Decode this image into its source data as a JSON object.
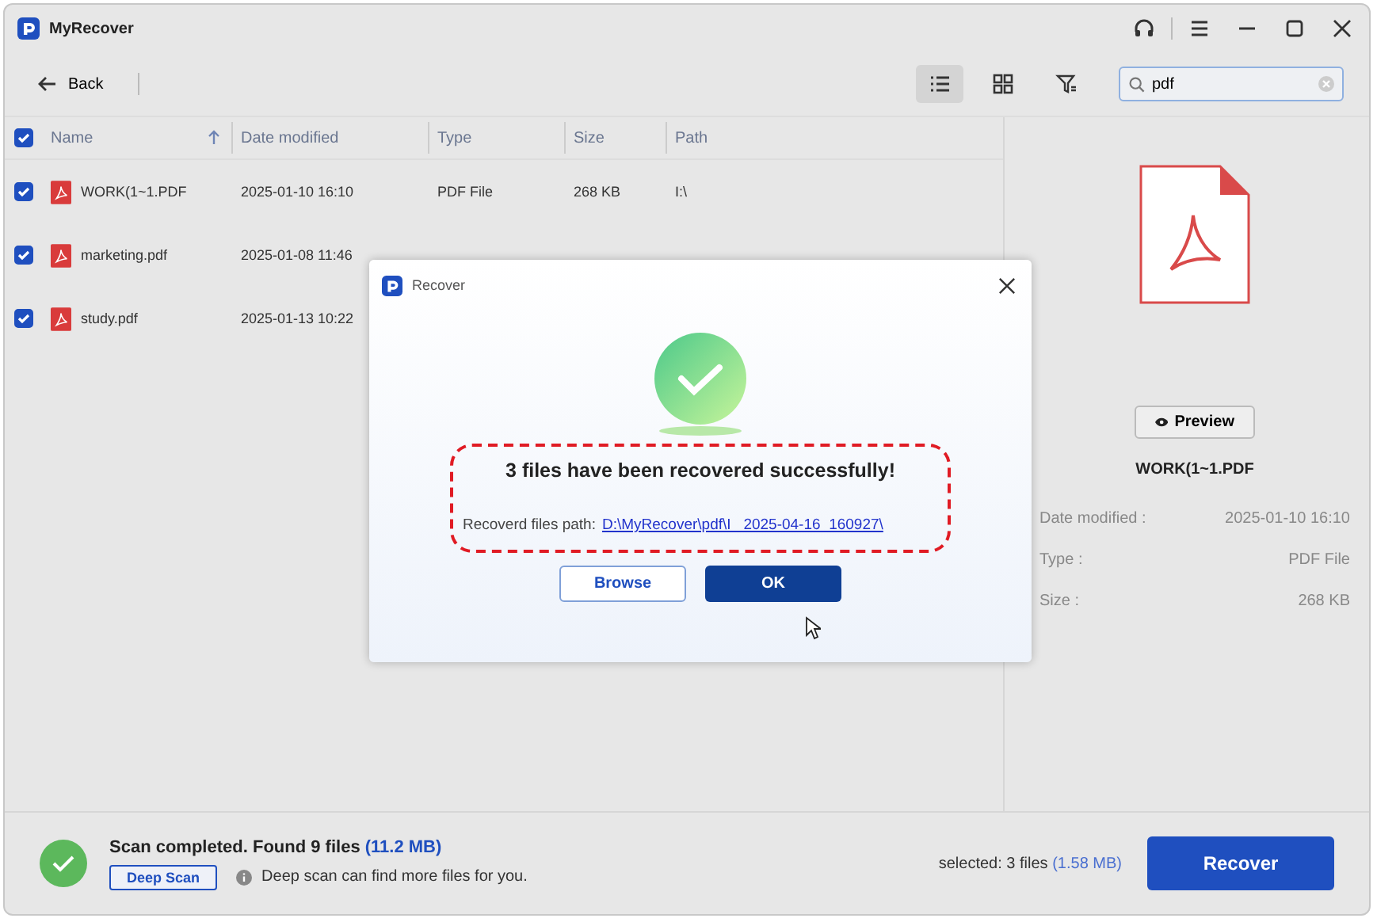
{
  "window": {
    "title": "MyRecover"
  },
  "toolbar": {
    "back": "Back",
    "views": [
      {
        "kind": "list",
        "selected": true
      },
      {
        "kind": "grid",
        "selected": false
      }
    ],
    "search": {
      "value": "pdf"
    }
  },
  "table": {
    "all_checked": true,
    "columns": [
      "Name",
      "Date modified",
      "Type",
      "Size",
      "Path"
    ],
    "rows": [
      {
        "checked": true,
        "name": "WORK(1~1.PDF",
        "date": "2025-01-10 16:10",
        "type": "PDF File",
        "size": "268 KB",
        "path": "I:\\"
      },
      {
        "checked": true,
        "name": "marketing.pdf",
        "date": "2025-01-08 11:46"
      },
      {
        "checked": true,
        "name": "study.pdf",
        "date": "2025-01-13 10:22"
      }
    ]
  },
  "details": {
    "preview": "Preview",
    "filename": "WORK(1~1.PDF",
    "fields": [
      {
        "label": "Date modified :",
        "value": "2025-01-10 16:10"
      },
      {
        "label": "Type :",
        "value": "PDF File"
      },
      {
        "label": "Size :",
        "value": "268 KB"
      }
    ]
  },
  "status": {
    "message": "Scan completed. Found 9 files",
    "total": "(11.2 MB)",
    "deep_scan": "Deep Scan",
    "hint": "Deep scan can find more files for you.",
    "selected": "selected: 3 files",
    "selected_size": "(1.58 MB)",
    "recover": "Recover"
  },
  "dialog": {
    "title": "Recover",
    "message": "3 files have been recovered successfully!",
    "path_label": "Recoverd files path:",
    "path": "D:\\MyRecover\\pdf\\I_ 2025-04-16_160927\\",
    "buttons": [
      {
        "label": "Browse",
        "kind": "secondary"
      },
      {
        "label": "OK",
        "kind": "primary"
      }
    ]
  }
}
